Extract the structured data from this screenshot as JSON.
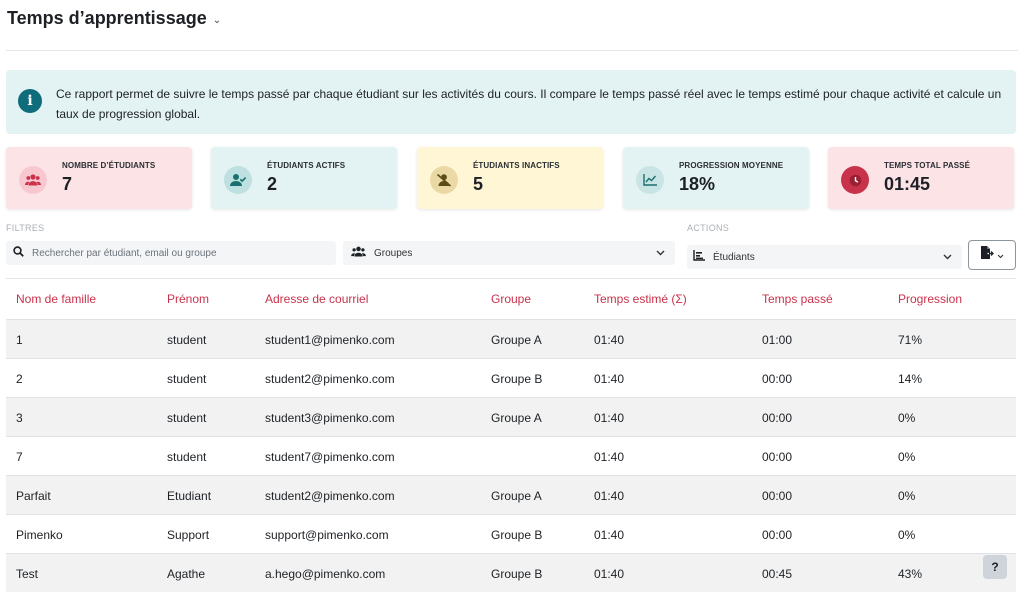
{
  "header": {
    "title": "Temps d’apprentissage"
  },
  "info": {
    "text": "Ce rapport permet de suivre le temps passé par chaque étudiant sur les activités du cours. Il compare le temps passé réel avec le temps estimé pour chaque activité et calcule un taux de progression global."
  },
  "stats": [
    {
      "label": "NOMBRE D’ÉTUDIANTS",
      "value": "7",
      "icon": "users-icon",
      "bg": "#fbe3e6",
      "icon_bg": "#f7c8d0",
      "icon_color": "#c8324b"
    },
    {
      "label": "ÉTUDIANTS ACTIFS",
      "value": "2",
      "icon": "user-check-icon",
      "bg": "#e3f2f2",
      "icon_bg": "#bfe0e0",
      "icon_color": "#1b6f6f"
    },
    {
      "label": "ÉTUDIANTS INACTIFS",
      "value": "5",
      "icon": "user-slash-icon",
      "bg": "#fff6d6",
      "icon_bg": "#ead9a4",
      "icon_color": "#5b4b16"
    },
    {
      "label": "PROGRESSION MOYENNE",
      "value": "18%",
      "icon": "chart-line-icon",
      "bg": "#e3f2f2",
      "icon_bg": "#c9e4e4",
      "icon_color": "#1b6f6f"
    },
    {
      "label": "TEMPS TOTAL PASSÉ",
      "value": "01:45",
      "icon": "clock-icon",
      "bg": "#fbe3e6",
      "icon_bg": "#c8324b",
      "icon_color": "#ffffff"
    }
  ],
  "filters": {
    "label": "FILTRES",
    "search_placeholder": "Rechercher par étudiant, email ou groupe",
    "groups_value": "Groupes"
  },
  "actions": {
    "label": "ACTIONS",
    "view_value": "Étudiants"
  },
  "table": {
    "headers": [
      "Nom de famille",
      "Prénom",
      "Adresse de courriel",
      "Groupe",
      "Temps estimé (Σ)",
      "Temps passé",
      "Progression"
    ],
    "rows": [
      [
        "1",
        "student",
        "student1@pimenko.com",
        "Groupe A",
        "01:40",
        "01:00",
        "71%"
      ],
      [
        "2",
        "student",
        "student2@pimenko.com",
        "Groupe B",
        "01:40",
        "00:00",
        "14%"
      ],
      [
        "3",
        "student",
        "student3@pimenko.com",
        "Groupe A",
        "01:40",
        "00:00",
        "0%"
      ],
      [
        "7",
        "student",
        "student7@pimenko.com",
        "",
        "01:40",
        "00:00",
        "0%"
      ],
      [
        "Parfait",
        "Etudiant",
        "student2@pimenko.com",
        "Groupe A",
        "01:40",
        "00:00",
        "0%"
      ],
      [
        "Pimenko",
        "Support",
        "support@pimenko.com",
        "Groupe B",
        "01:40",
        "00:00",
        "0%"
      ],
      [
        "Test",
        "Agathe",
        "a.hego@pimenko.com",
        "Groupe B",
        "01:40",
        "00:45",
        "43%"
      ]
    ]
  },
  "help": {
    "label": "?"
  }
}
